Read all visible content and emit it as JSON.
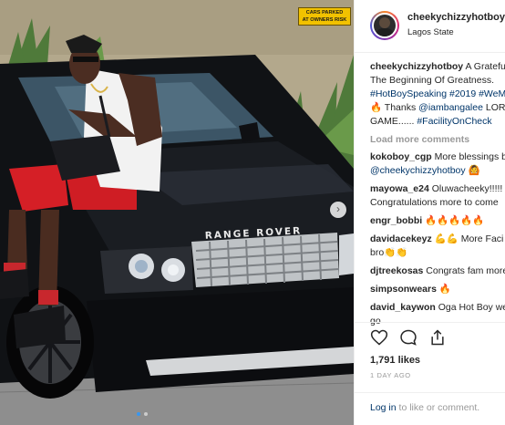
{
  "photo": {
    "sign_line1": "CARS PARKED",
    "sign_line2": "AT OWNERS RISK",
    "plate_text": "RANGE ROVER",
    "next_arrow": "›"
  },
  "post": {
    "username": "cheekychizzyhotboy",
    "header_dot": "•",
    "location": "Lagos State",
    "caption": {
      "username": "cheekychizzyhotboy",
      "line1_text": " A Grateful",
      "line2_text": "The Beginning Of Greatness.",
      "line3_tags": "#HotBoySpeaking #2019 #WeM",
      "line4_emoji": "🔥",
      "line4_text": " Thanks ",
      "line4_tag": "@iambangalee",
      "line4_rest": " LORD",
      "line5_text": "GAME...... ",
      "line5_tag": "#FacilityOnCheck"
    },
    "load_more": "Load more comments",
    "comments": [
      {
        "user": "kokoboy_cgp",
        "text": " More blessings b",
        "line2_tag": "@cheekychizzyhotboy",
        "line2_text": " 🙆"
      },
      {
        "user": "mayowa_e24",
        "text": " Oluwacheeky!!!!!",
        "line2_text": "Congratulations more to come"
      },
      {
        "user": "engr_bobbi",
        "text": " 🔥🔥🔥🔥🔥"
      },
      {
        "user": "davidacekeyz",
        "text": " 💪💪 More Faci",
        "line2_text": "bro👏👏"
      },
      {
        "user": "djtreekosas",
        "text": " Congrats fam more"
      },
      {
        "user": "simpsonwears",
        "text": " 🔥"
      },
      {
        "user": "david_kaywon",
        "text": " Oga Hot Boy we",
        "line2_text": "go"
      }
    ],
    "likes": "1,791 likes",
    "time_ago": "1 DAY AGO",
    "login_link": "Log in",
    "login_text": " to like or comment."
  },
  "icons": [
    "heart-icon",
    "comment-icon",
    "share-icon"
  ],
  "colors": {
    "link": "#003569",
    "muted": "#999999",
    "carousel_active": "#3897f0"
  }
}
